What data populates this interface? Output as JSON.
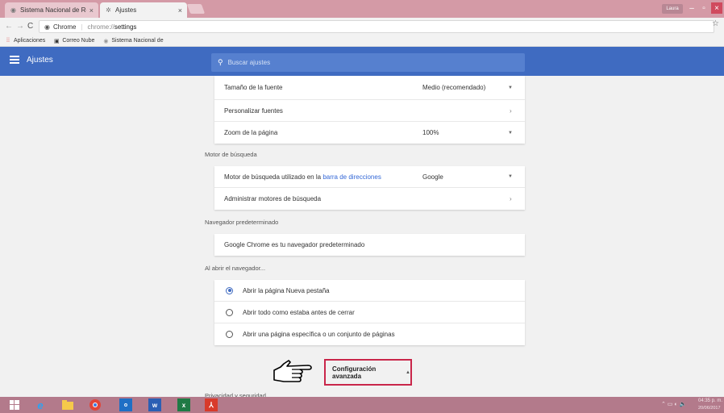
{
  "tabs": [
    {
      "label": "Sistema Nacional de Re|",
      "close": "×"
    },
    {
      "label": "Ajustes",
      "close": "×"
    }
  ],
  "window": {
    "user": "Laura",
    "minimize": "–",
    "maximize": "▫",
    "close": "×"
  },
  "address": {
    "site": "Chrome",
    "scheme": "chrome://",
    "path": "settings"
  },
  "bookmarks": [
    {
      "label": "Aplicaciones",
      "icon": "apps-grid-icon"
    },
    {
      "label": "Correo Nube",
      "icon": "mail-icon"
    },
    {
      "label": "Sistema Nacional de",
      "icon": "globe-icon"
    }
  ],
  "header": {
    "title": "Ajustes",
    "search_placeholder": "Buscar ajustes"
  },
  "appearance": {
    "font_size_label": "Tamaño de la fuente",
    "font_size_value": "Medio (recomendado)",
    "custom_fonts_label": "Personalizar fuentes",
    "zoom_label": "Zoom de la página",
    "zoom_value": "100%"
  },
  "search_engine": {
    "section_title": "Motor de búsqueda",
    "engine_label_prefix": "Motor de búsqueda utilizado en la",
    "engine_label_link": "barra de direcciones",
    "engine_value": "Google",
    "manage_label": "Administrar motores de búsqueda"
  },
  "default_browser": {
    "section_title": "Navegador predeterminado",
    "status": "Google Chrome es tu navegador predeterminado"
  },
  "startup": {
    "section_title": "Al abrir el navegador...",
    "options": [
      {
        "label": "Abrir la página Nueva pestaña",
        "selected": true
      },
      {
        "label": "Abrir todo como estaba antes de cerrar",
        "selected": false
      },
      {
        "label": "Abrir una página específica o un conjunto de páginas",
        "selected": false
      }
    ]
  },
  "advanced": {
    "label": "Configuración avanzada",
    "arrow": "▲"
  },
  "privacy": {
    "section_title": "Privacidad y seguridad"
  },
  "tray": {
    "time": "04:35 p. m.",
    "date": "20/06/2017"
  },
  "colors": {
    "header": "#3f6bc1",
    "highlight": "#c9264a",
    "taskbar": "#b37a8b"
  }
}
